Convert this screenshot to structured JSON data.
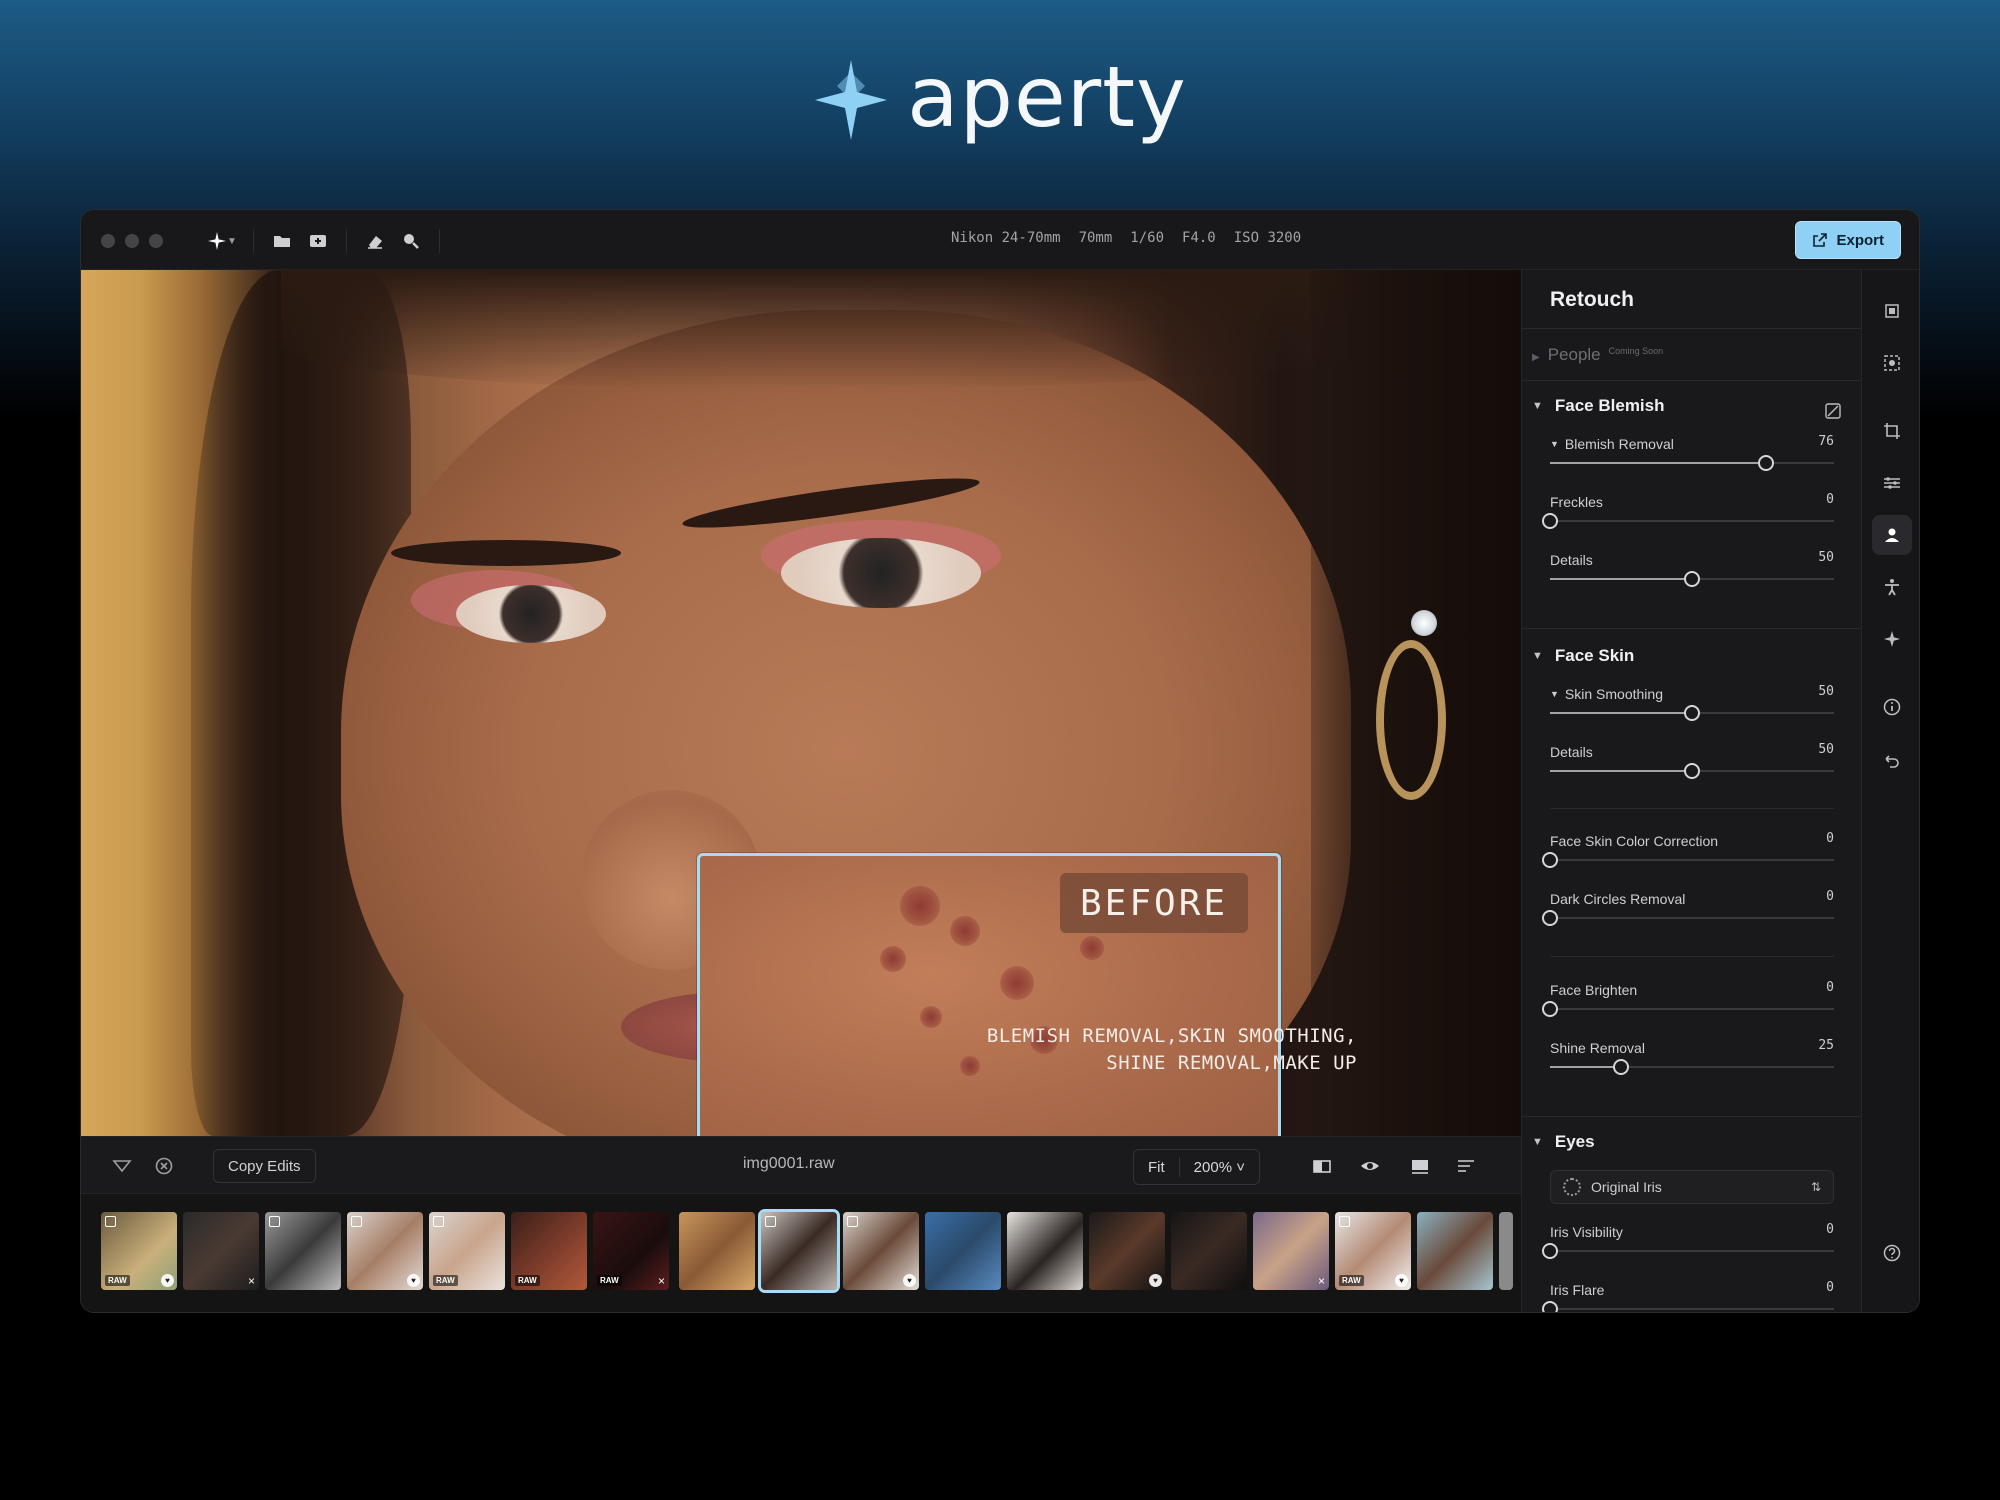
{
  "brand": {
    "name": "aperty",
    "accent": "#8fd0f5"
  },
  "toolbar": {
    "exif": [
      "Nikon 24-70mm",
      "70mm",
      "1/60",
      "F4.0",
      "ISO 3200"
    ],
    "export_label": "Export"
  },
  "canvas": {
    "before_label": "BEFORE",
    "caption_line1": "BLEMISH REMOVAL,SKIN SMOOTHING,",
    "caption_line2": "SHINE REMOVAL,MAKE UP"
  },
  "bottombar": {
    "copy_edits": "Copy Edits",
    "filename": "img0001.raw",
    "fit": "Fit",
    "zoom": "200% ˅"
  },
  "filmstrip": {
    "raw_badge": "RAW",
    "selected_index": 8
  },
  "panel": {
    "title": "Retouch",
    "people": {
      "label": "People",
      "badge": "Coming Soon"
    },
    "face_blemish": {
      "title": "Face Blemish",
      "blemish_removal": {
        "label": "Blemish Removal",
        "value": "76",
        "level": 0.76
      },
      "freckles": {
        "label": "Freckles",
        "value": "0",
        "level": 0.0
      },
      "details": {
        "label": "Details",
        "value": "50",
        "level": 0.5
      }
    },
    "face_skin": {
      "title": "Face Skin",
      "skin_smoothing": {
        "label": "Skin Smoothing",
        "value": "50",
        "level": 0.5
      },
      "details": {
        "label": "Details",
        "value": "50",
        "level": 0.5
      },
      "color_correction": {
        "label": "Face Skin Color Correction",
        "value": "0",
        "level": 0.0
      },
      "dark_circles": {
        "label": "Dark Circles Removal",
        "value": "0",
        "level": 0.0
      },
      "brighten": {
        "label": "Face Brighten",
        "value": "0",
        "level": 0.0
      },
      "shine_removal": {
        "label": "Shine Removal",
        "value": "25",
        "level": 0.25
      }
    },
    "eyes": {
      "title": "Eyes",
      "iris_select": "Original Iris",
      "iris_visibility": {
        "label": "Iris Visibility",
        "value": "0",
        "level": 0.0
      },
      "iris_flare": {
        "label": "Iris Flare",
        "value": "0",
        "level": 0.0
      }
    }
  }
}
